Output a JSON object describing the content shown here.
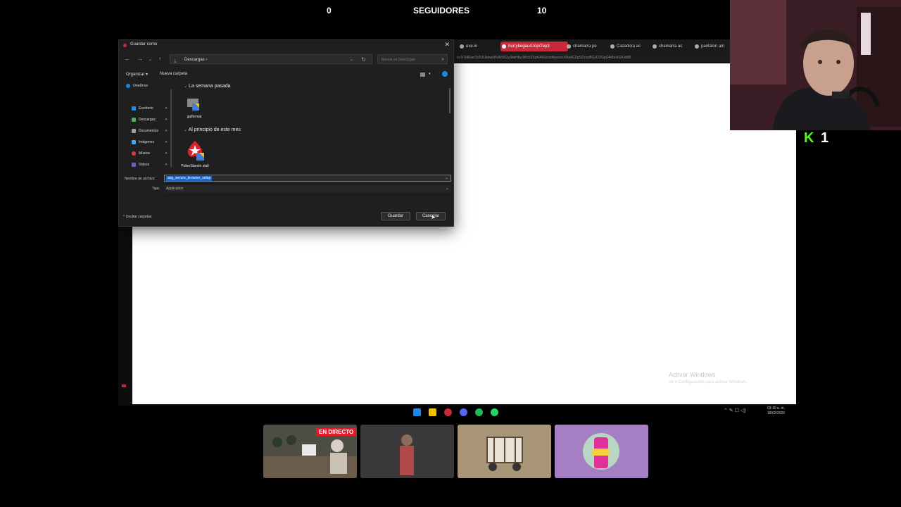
{
  "overlay": {
    "left_count": "0",
    "title": "SEGUIDORES",
    "right_count": "10"
  },
  "browser": {
    "tabs": [
      {
        "label": "exe.io"
      },
      {
        "label": "hurrybegaud.top/2ep3"
      },
      {
        "label": "chamarra pe"
      },
      {
        "label": "Cazadora ac"
      },
      {
        "label": "chamarra ac"
      },
      {
        "label": "pantalon am"
      }
    ],
    "url": "bi-N7MEwcTc0ULIkbwoHsNiS62y3bkH8y3Wc5ZXpKA6Sxxbf4ywoz/XNa4CZgSZozyl8GJCDGpO4dbcKGKaMB"
  },
  "dialog": {
    "title": "Guardar como",
    "close": "✕",
    "path": "Descargas  ›",
    "search_placeholder": "Buscar en Descargas",
    "organize": "Organizar ▾",
    "new_folder": "Nueva carpeta",
    "sidebar": [
      {
        "label": "OneDrive",
        "color": "#1e88e5"
      },
      {
        "label": "Escritorio",
        "color": "#1e88e5"
      },
      {
        "label": "Descargas",
        "color": "#4caf50"
      },
      {
        "label": "Documentos",
        "color": "#9e9e9e"
      },
      {
        "label": "Imágenes",
        "color": "#42a5f5"
      },
      {
        "label": "Música",
        "color": "#e53935"
      },
      {
        "label": "Videos",
        "color": "#7e57c2"
      }
    ],
    "group_week": "La semana pasada",
    "group_month": "Al principio de este mes",
    "files": [
      {
        "label": "guiformat"
      },
      {
        "label": "PokerStarsIn stall"
      }
    ],
    "filename_label": "Nombre de archivo:",
    "filename_value": "avg_secure_browser_setup",
    "type_label": "Tipo:",
    "type_value": "Application",
    "hide_folders": "^ Ocultar carpetas",
    "save_button": "Guardar",
    "cancel_button": "Cancelar"
  },
  "watermark": {
    "title": "Activar Windows",
    "subtitle": "Ve a Configuración para activar Windows."
  },
  "kick": {
    "logo": "K",
    "count": "1"
  },
  "taskbar": {
    "time": "03:10 a. m.",
    "date": "18/02/2026"
  },
  "thumbnails": {
    "live_badge": "EN DIRECTO"
  },
  "colors": {
    "accent": "#c9293a",
    "kick_green": "#53fc18",
    "selection_blue": "#1e66c8"
  }
}
